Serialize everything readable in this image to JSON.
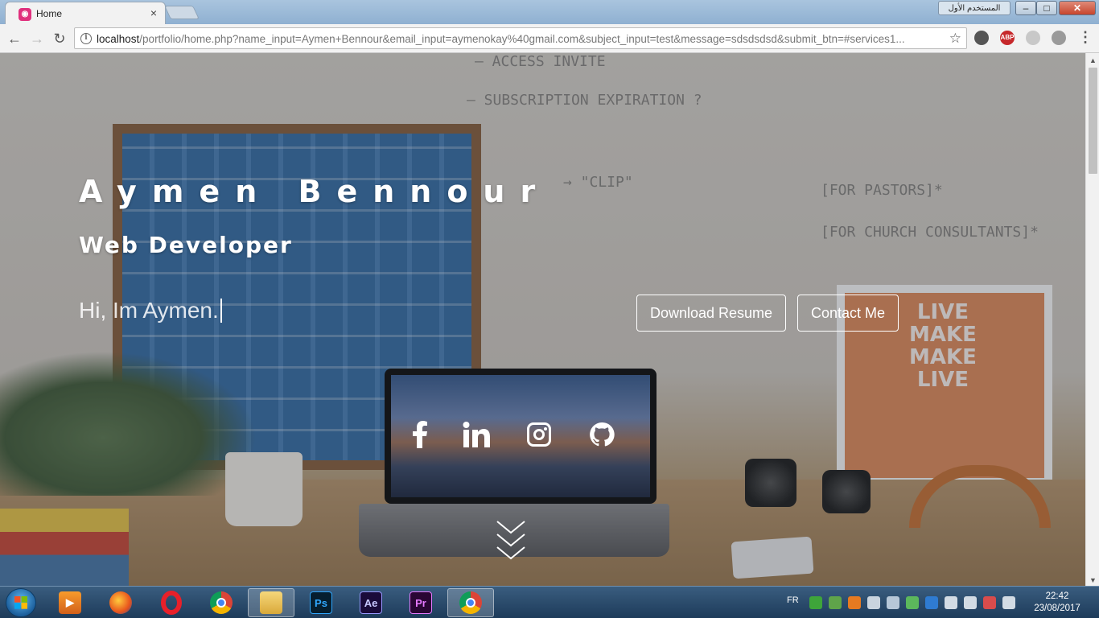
{
  "browser": {
    "tab_title": "Home",
    "tab_close": "×",
    "profile_label": "المستخدم الأول",
    "window_buttons": {
      "minimize": "–",
      "maximize": "□",
      "close": "✕"
    },
    "nav": {
      "back": "←",
      "forward": "→",
      "reload": "↻"
    },
    "url_host": "localhost",
    "url_rest": "/portfolio/home.php?name_input=Aymen+Bennour&email_input=aymenokay%40gmail.com&subject_input=test&message=sdsdsdsd&submit_btn=#services1...",
    "bookmark_icon": "☆",
    "extensions": {
      "abp": "ABP"
    },
    "menu_icon": "⋮"
  },
  "hero": {
    "name": "Aymen Bennour",
    "role": "Web Developer",
    "typed_text": "Hi, Im Aymen.",
    "buttons": {
      "resume": "Download Resume",
      "contact": "Contact Me"
    },
    "social_icons": [
      "facebook-icon",
      "linkedin-icon",
      "instagram-icon",
      "github-icon"
    ]
  },
  "taskbar": {
    "language": "FR",
    "time": "22:42",
    "date": "23/08/2017",
    "apps": [
      {
        "name": "media-player",
        "label": ""
      },
      {
        "name": "firefox",
        "label": ""
      },
      {
        "name": "opera",
        "label": ""
      },
      {
        "name": "chrome",
        "label": ""
      },
      {
        "name": "file-explorer",
        "label": ""
      },
      {
        "name": "photoshop",
        "label": "Ps"
      },
      {
        "name": "after-effects",
        "label": "Ae"
      },
      {
        "name": "premiere",
        "label": "Pr"
      },
      {
        "name": "chrome-active",
        "label": ""
      }
    ]
  },
  "colors": {
    "overlay_text": "#ffffff",
    "tab_favicon": "#e0307d",
    "taskbar": "#1d3b5a"
  }
}
